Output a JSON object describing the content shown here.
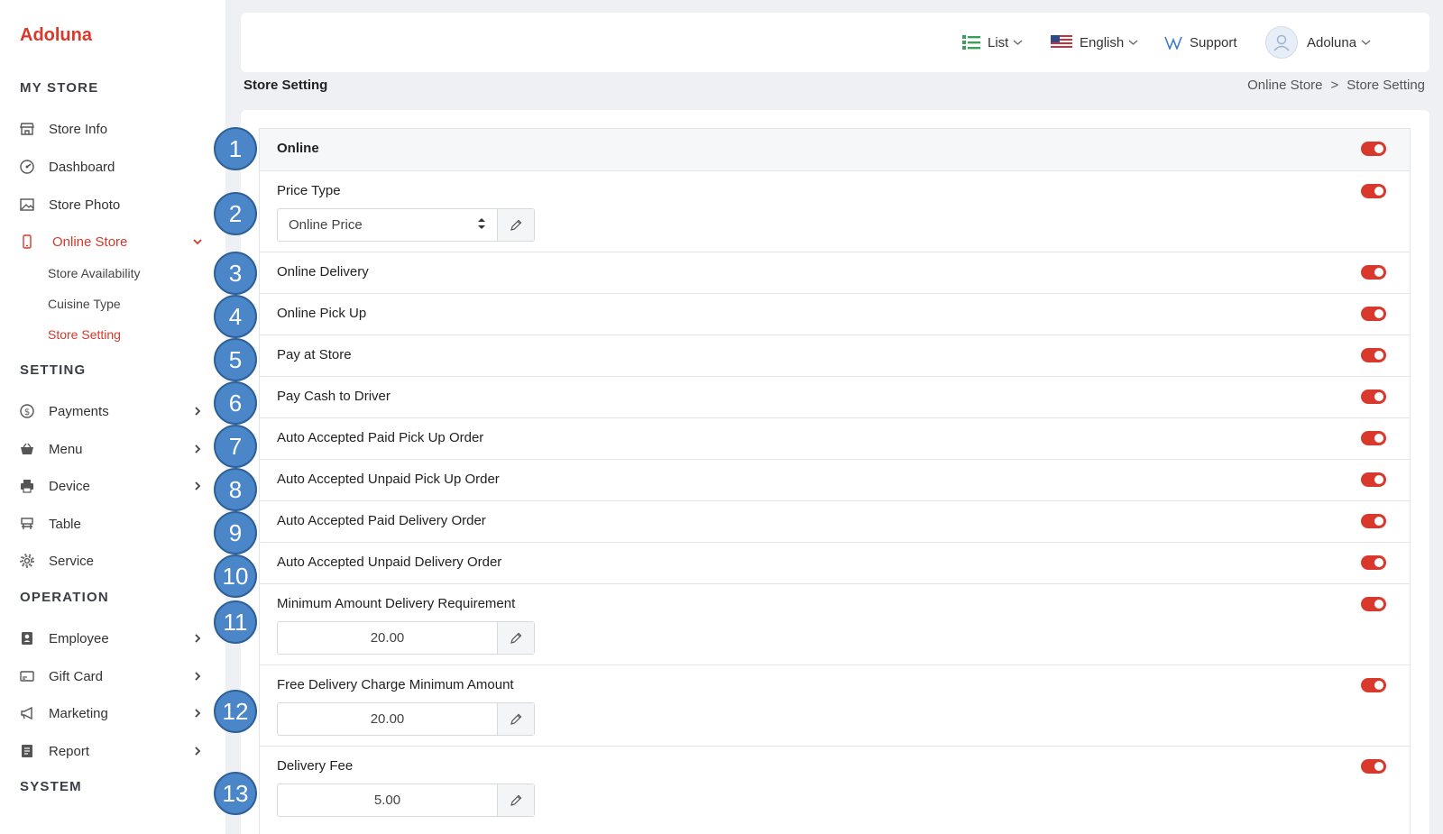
{
  "brand": "Adoluna",
  "sidebar": {
    "sections": {
      "my_store": "MY STORE",
      "setting": "SETTING",
      "operation": "OPERATION",
      "system": "SYSTEM"
    },
    "items": {
      "store_info": "Store Info",
      "dashboard": "Dashboard",
      "store_photo": "Store Photo",
      "online_store": "Online Store",
      "payments": "Payments",
      "menu": "Menu",
      "device": "Device",
      "table": "Table",
      "service": "Service",
      "employee": "Employee",
      "gift_card": "Gift Card",
      "marketing": "Marketing",
      "report": "Report"
    },
    "online_store_sub": {
      "availability": "Store Availability",
      "cuisine": "Cuisine Type",
      "setting": "Store Setting"
    },
    "active_color": "#d9382c"
  },
  "header": {
    "view": "List",
    "language": "English",
    "support": "Support",
    "user": "Adoluna"
  },
  "page": {
    "title": "Store Setting",
    "breadcrumb": [
      "Online Store",
      ">",
      "Store Setting"
    ]
  },
  "settings": [
    {
      "num": "1",
      "label": "Online",
      "enabled": true
    },
    {
      "num": "2",
      "label": "Price Type",
      "enabled": true,
      "select": "Online Price"
    },
    {
      "num": "3",
      "label": "Online Delivery",
      "enabled": true
    },
    {
      "num": "4",
      "label": "Online Pick Up",
      "enabled": true
    },
    {
      "num": "5",
      "label": "Pay at Store",
      "enabled": true
    },
    {
      "num": "6",
      "label": "Pay Cash to Driver",
      "enabled": true
    },
    {
      "num": "7",
      "label": "Auto Accepted Paid Pick Up Order",
      "enabled": true
    },
    {
      "num": "8",
      "label": "Auto Accepted Unpaid Pick Up Order",
      "enabled": true
    },
    {
      "num": "9",
      "label": "Auto Accepted Paid Delivery Order",
      "enabled": true
    },
    {
      "num": "10",
      "label": "Auto Accepted Unpaid Delivery Order",
      "enabled": true
    },
    {
      "num": "11",
      "label": "Minimum Amount Delivery Requirement",
      "enabled": true,
      "value": "20.00"
    },
    {
      "num": "12",
      "label": "Free Delivery Charge Minimum Amount",
      "enabled": true,
      "value": "20.00"
    },
    {
      "num": "13",
      "label": "Delivery Fee",
      "enabled": true,
      "value": "5.00"
    }
  ],
  "colors": {
    "accent": "#d9382c",
    "badge": "#4a86c8"
  }
}
